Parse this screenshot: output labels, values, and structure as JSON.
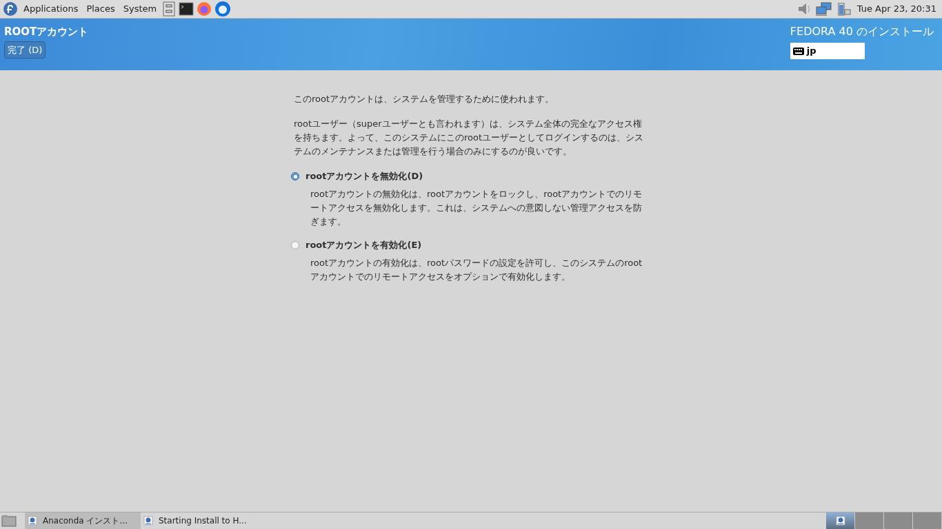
{
  "top_panel": {
    "menus": [
      "Applications",
      "Places",
      "System"
    ],
    "clock": "Tue Apr 23, 20:31"
  },
  "header": {
    "title": "ROOTアカウント",
    "done_button": "完了 (D)",
    "product": "FEDORA 40 のインストール",
    "keyboard_layout": "jp"
  },
  "intro": [
    "このrootアカウントは、システムを管理するために使われます。",
    "rootユーザー（superユーザーとも言われます）は、システム全体の完全なアクセス権を持ちます。よって、このシステムにこのrootユーザーとしてログインするのは、システムのメンテナンスまたは管理を行う場合のみにするのが良いです。"
  ],
  "options": [
    {
      "label": "rootアカウントを無効化(D)",
      "selected": true,
      "description": "rootアカウントの無効化は、rootアカウントをロックし、rootアカウントでのリモートアクセスを無効化します。これは、システムへの意図しない管理アクセスを防ぎます。"
    },
    {
      "label": "rootアカウントを有効化(E)",
      "selected": false,
      "description": "rootアカウントの有効化は、rootパスワードの設定を許可し、このシステムのrootアカウントでのリモートアクセスをオプションで有効化します。"
    }
  ],
  "taskbar": {
    "tasks": [
      {
        "label": "Anaconda インスト...",
        "selected": true
      },
      {
        "label": "Starting Install to H...",
        "selected": false
      }
    ],
    "workspaces": [
      {
        "selected": true,
        "has_window": true
      },
      {
        "selected": false,
        "has_window": false
      },
      {
        "selected": false,
        "has_window": false
      },
      {
        "selected": false,
        "has_window": false
      }
    ]
  }
}
